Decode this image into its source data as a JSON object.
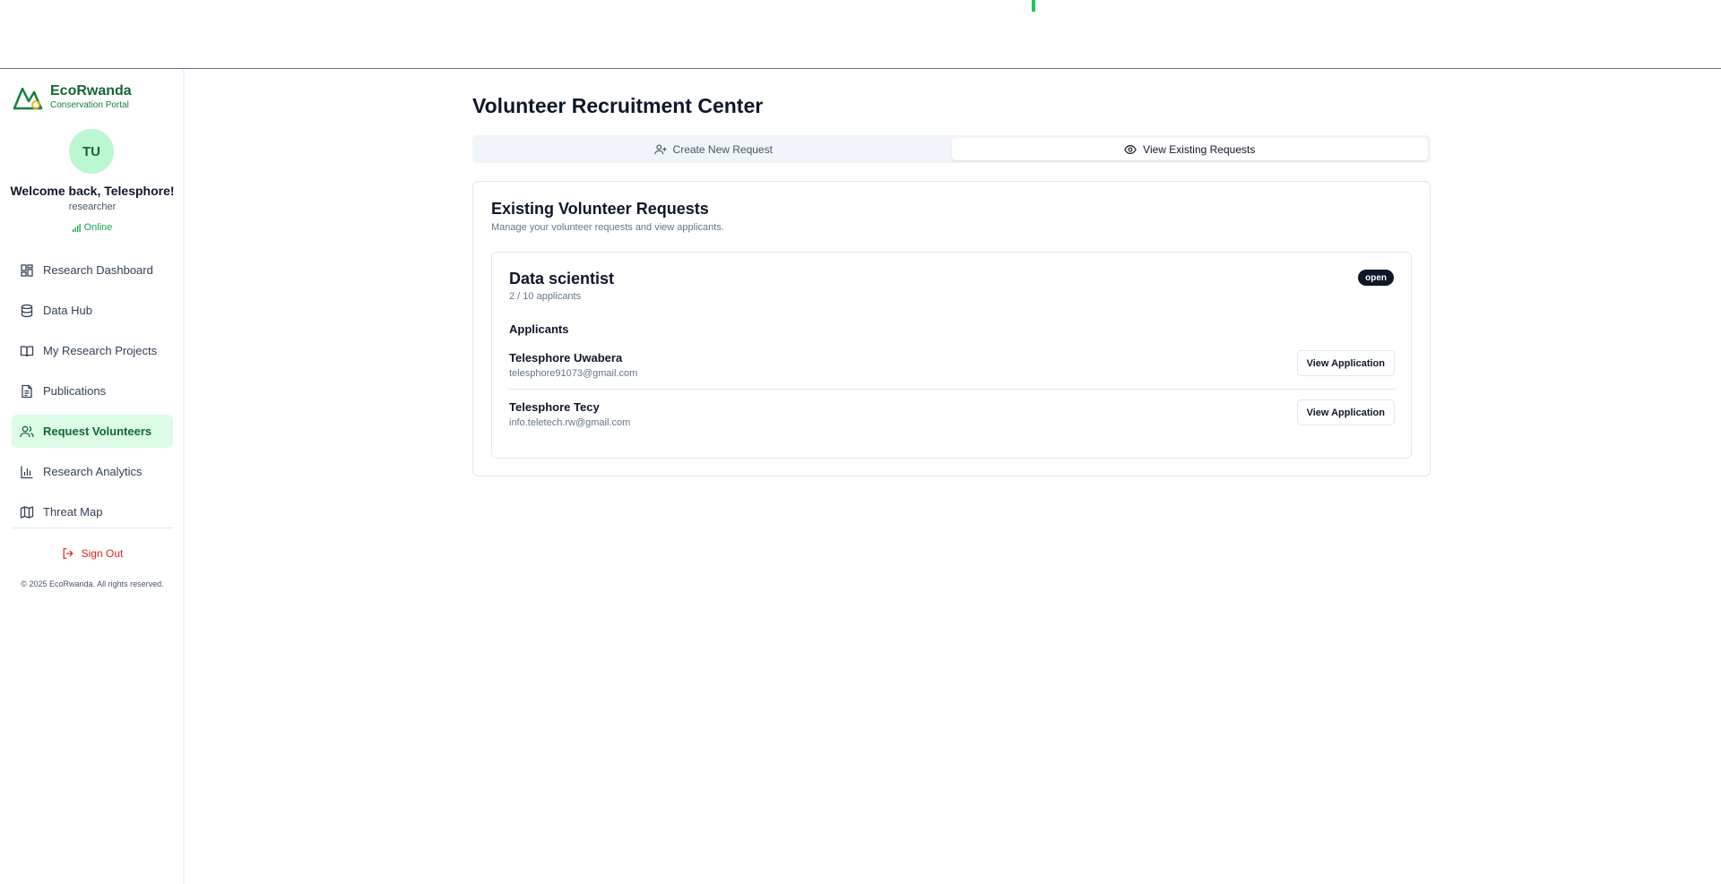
{
  "brand": {
    "name": "EcoRwanda",
    "subtitle": "Conservation Portal"
  },
  "user": {
    "initials": "TU",
    "welcome": "Welcome back, Telesphore!",
    "role": "researcher",
    "status": "Online"
  },
  "sidebar": {
    "items": [
      {
        "label": "Research Dashboard",
        "icon": "dashboard-icon",
        "active": false
      },
      {
        "label": "Data Hub",
        "icon": "database-icon",
        "active": false
      },
      {
        "label": "My Research Projects",
        "icon": "book-open-icon",
        "active": false
      },
      {
        "label": "Publications",
        "icon": "document-icon",
        "active": false
      },
      {
        "label": "Request Volunteers",
        "icon": "users-icon",
        "active": true
      },
      {
        "label": "Research Analytics",
        "icon": "bar-chart-icon",
        "active": false
      },
      {
        "label": "Threat Map",
        "icon": "map-icon",
        "active": false
      }
    ],
    "sign_out": "Sign Out",
    "copyright": "© 2025 EcoRwanda. All rights reserved."
  },
  "main": {
    "title": "Volunteer Recruitment Center",
    "tabs": [
      {
        "label": "Create New Request",
        "icon": "user-plus-icon",
        "active": false
      },
      {
        "label": "View Existing Requests",
        "icon": "eye-icon",
        "active": true
      }
    ],
    "card": {
      "title": "Existing Volunteer Requests",
      "description": "Manage your volunteer requests and view applicants.",
      "request": {
        "title": "Data scientist",
        "count": "2 / 10 applicants",
        "badge": "open",
        "applicants_heading": "Applicants",
        "applicants": [
          {
            "name": "Telesphore Uwabera",
            "email": "telesphore91073@gmail.com",
            "button": "View Application"
          },
          {
            "name": "Telesphore Tecy",
            "email": "info.teletech.rw@gmail.com",
            "button": "View Application"
          }
        ]
      }
    }
  },
  "colors": {
    "accent": "#166534",
    "active_bg": "#dcfce7",
    "danger": "#dc2626",
    "badge_bg": "#0f172a"
  }
}
